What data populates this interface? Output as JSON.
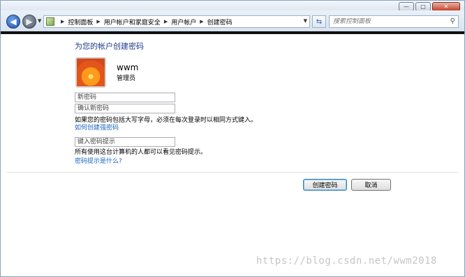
{
  "window": {
    "minimize_glyph": "—",
    "maximize_glyph": "▢",
    "close_glyph": "✕"
  },
  "nav": {
    "back_glyph": "◀",
    "forward_glyph": "▶",
    "history_glyph": "▼",
    "breadcrumbs": [
      "控制面板",
      "用户帐户和家庭安全",
      "用户帐户",
      "创建密码"
    ],
    "crumb_separator": "▶",
    "address_dropdown_glyph": "▼",
    "refresh_glyph": "⇆",
    "search_placeholder": "搜索控制面板",
    "search_glyph": "⚲"
  },
  "page": {
    "heading": "为您的帐户创建密码",
    "user": {
      "name": "wwm",
      "role": "管理员"
    },
    "fields": {
      "new_password_placeholder": "新密码",
      "confirm_password_placeholder": "确认新密码",
      "hint_placeholder": "键入密码提示"
    },
    "case_note": "如果您的密码包括大写字母，必须在每次登录时以相同方式键入。",
    "strong_password_link": "如何创建强密码",
    "hint_note": "所有使用这台计算机的人都可以看见密码提示。",
    "hint_link": "密码提示是什么?",
    "buttons": {
      "create": "创建密码",
      "cancel": "取消"
    }
  },
  "watermark": "https://blog.csdn.net/wwm2018",
  "colors": {
    "heading": "#1e3a8a",
    "link": "#1565c0",
    "titlebar": "#dfe8f2",
    "band": "#101010"
  }
}
